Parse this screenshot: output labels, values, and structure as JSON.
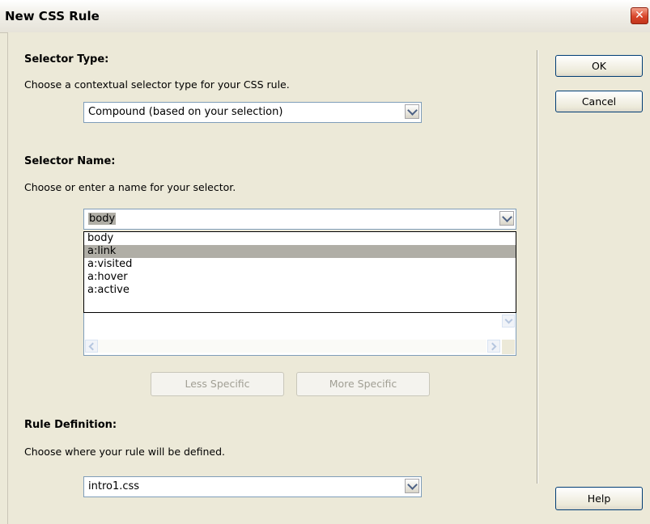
{
  "window": {
    "title": "New CSS Rule",
    "close_glyph": "✕"
  },
  "selector_type": {
    "heading": "Selector Type:",
    "description": "Choose a contextual selector type for your CSS rule.",
    "selected": "Compound (based on your selection)"
  },
  "selector_name": {
    "heading": "Selector Name:",
    "description": "Choose or enter a name for your selector.",
    "value": "body",
    "options": [
      "body",
      "a:link",
      "a:visited",
      "a:hover",
      "a:active"
    ],
    "highlighted": "a:link"
  },
  "specificity": {
    "less_label": "Less Specific",
    "more_label": "More Specific"
  },
  "rule_definition": {
    "heading": "Rule Definition:",
    "description": "Choose where your rule will be defined.",
    "selected": "intro1.css"
  },
  "buttons": {
    "ok": "OK",
    "cancel": "Cancel",
    "help": "Help"
  },
  "colors": {
    "highlight": "#b0aea6",
    "dialog_bg": "#ece9d8",
    "close_red": "#d8452a"
  },
  "icons": {
    "close": "close-icon",
    "dropdown": "chevron-down-icon"
  }
}
